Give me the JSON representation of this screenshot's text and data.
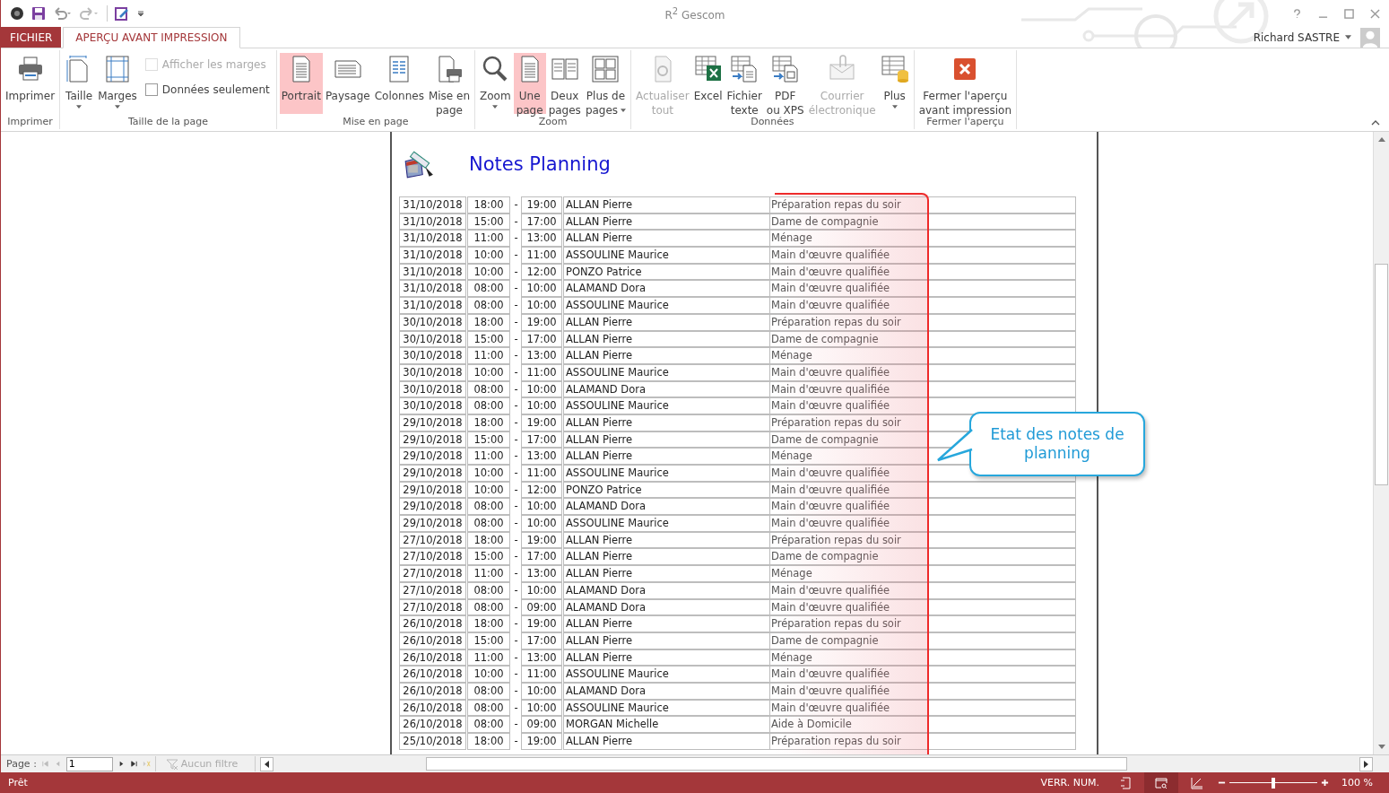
{
  "window": {
    "title": "R$^{2}$ Gescom"
  },
  "user": {
    "name": "Richard SASTRE"
  },
  "tabs": [
    {
      "label": "FICHIER",
      "kind": "file",
      "selected": false
    },
    {
      "label": "APERÇU AVANT IMPRESSION",
      "kind": "tab",
      "selected": true
    }
  ],
  "ribbon": {
    "groups": [
      {
        "label": "Imprimer",
        "items": [
          {
            "kind": "button",
            "lines": [
              "Imprimer"
            ],
            "selected": false,
            "disabled": false,
            "dropdown": false
          }
        ]
      },
      {
        "label": "Taille de la page",
        "items": [
          {
            "kind": "button",
            "lines": [
              "Taille"
            ],
            "selected": false,
            "disabled": false,
            "dropdown": true
          },
          {
            "kind": "button",
            "lines": [
              "Marges"
            ],
            "selected": false,
            "disabled": false,
            "dropdown": true
          },
          {
            "kind": "checks",
            "checks": [
              {
                "label": "Afficher les marges",
                "checked": false,
                "disabled": true
              },
              {
                "label": "Données seulement",
                "checked": false,
                "disabled": false
              }
            ]
          }
        ]
      },
      {
        "label": "Mise en page",
        "items": [
          {
            "kind": "button",
            "lines": [
              "Portrait"
            ],
            "selected": true,
            "disabled": false,
            "dropdown": false
          },
          {
            "kind": "button",
            "lines": [
              "Paysage"
            ],
            "selected": false,
            "disabled": false,
            "dropdown": false
          },
          {
            "kind": "button",
            "lines": [
              "Colonnes"
            ],
            "selected": false,
            "disabled": false,
            "dropdown": false
          },
          {
            "kind": "button",
            "lines": [
              "Mise en",
              "page"
            ],
            "selected": false,
            "disabled": false,
            "dropdown": false
          }
        ]
      },
      {
        "label": "Zoom",
        "items": [
          {
            "kind": "button",
            "lines": [
              "Zoom"
            ],
            "selected": false,
            "disabled": false,
            "dropdown": true
          },
          {
            "kind": "button",
            "lines": [
              "Une",
              "page"
            ],
            "selected": true,
            "disabled": false,
            "dropdown": false
          },
          {
            "kind": "button",
            "lines": [
              "Deux",
              "pages"
            ],
            "selected": false,
            "disabled": false,
            "dropdown": false
          },
          {
            "kind": "button",
            "lines": [
              "Plus de",
              "pages"
            ],
            "selected": false,
            "disabled": false,
            "dropdown": true
          }
        ]
      },
      {
        "label": "Données",
        "items": [
          {
            "kind": "button",
            "lines": [
              "Actualiser",
              "tout"
            ],
            "selected": false,
            "disabled": true,
            "dropdown": false
          },
          {
            "kind": "button",
            "lines": [
              "Excel"
            ],
            "selected": false,
            "disabled": false,
            "dropdown": false
          },
          {
            "kind": "button",
            "lines": [
              "Fichier",
              "texte"
            ],
            "selected": false,
            "disabled": false,
            "dropdown": false
          },
          {
            "kind": "button",
            "lines": [
              "PDF",
              "ou XPS"
            ],
            "selected": false,
            "disabled": false,
            "dropdown": false
          },
          {
            "kind": "button",
            "lines": [
              "Courrier",
              "électronique"
            ],
            "selected": false,
            "disabled": true,
            "dropdown": false
          },
          {
            "kind": "button",
            "lines": [
              "Plus"
            ],
            "selected": false,
            "disabled": false,
            "dropdown": true
          }
        ]
      },
      {
        "label": "Fermer l'aperçu",
        "items": [
          {
            "kind": "button",
            "lines": [
              "Fermer l'aperçu",
              "avant impression"
            ],
            "selected": false,
            "disabled": false,
            "dropdown": false
          }
        ]
      }
    ]
  },
  "report": {
    "title": "Notes Planning",
    "rows": [
      {
        "date": "31/10/2018",
        "start": "18:00",
        "sep": "-",
        "end": "19:00",
        "name": "ALLAN Pierre",
        "task": "Préparation repas du soir"
      },
      {
        "date": "31/10/2018",
        "start": "15:00",
        "sep": "-",
        "end": "17:00",
        "name": "ALLAN Pierre",
        "task": "Dame de compagnie"
      },
      {
        "date": "31/10/2018",
        "start": "11:00",
        "sep": "-",
        "end": "13:00",
        "name": "ALLAN Pierre",
        "task": "Ménage"
      },
      {
        "date": "31/10/2018",
        "start": "10:00",
        "sep": "-",
        "end": "11:00",
        "name": "ASSOULINE Maurice",
        "task": "Main d'œuvre qualifiée"
      },
      {
        "date": "31/10/2018",
        "start": "10:00",
        "sep": "-",
        "end": "12:00",
        "name": "PONZO Patrice",
        "task": "Main d'œuvre qualifiée"
      },
      {
        "date": "31/10/2018",
        "start": "08:00",
        "sep": "-",
        "end": "10:00",
        "name": "ALAMAND Dora",
        "task": "Main d'œuvre qualifiée"
      },
      {
        "date": "31/10/2018",
        "start": "08:00",
        "sep": "-",
        "end": "10:00",
        "name": "ASSOULINE Maurice",
        "task": "Main d'œuvre qualifiée"
      },
      {
        "date": "30/10/2018",
        "start": "18:00",
        "sep": "-",
        "end": "19:00",
        "name": "ALLAN Pierre",
        "task": "Préparation repas du soir"
      },
      {
        "date": "30/10/2018",
        "start": "15:00",
        "sep": "-",
        "end": "17:00",
        "name": "ALLAN Pierre",
        "task": "Dame de compagnie"
      },
      {
        "date": "30/10/2018",
        "start": "11:00",
        "sep": "-",
        "end": "13:00",
        "name": "ALLAN Pierre",
        "task": "Ménage"
      },
      {
        "date": "30/10/2018",
        "start": "10:00",
        "sep": "-",
        "end": "11:00",
        "name": "ASSOULINE Maurice",
        "task": "Main d'œuvre qualifiée"
      },
      {
        "date": "30/10/2018",
        "start": "08:00",
        "sep": "-",
        "end": "10:00",
        "name": "ALAMAND Dora",
        "task": "Main d'œuvre qualifiée"
      },
      {
        "date": "30/10/2018",
        "start": "08:00",
        "sep": "-",
        "end": "10:00",
        "name": "ASSOULINE Maurice",
        "task": "Main d'œuvre qualifiée"
      },
      {
        "date": "29/10/2018",
        "start": "18:00",
        "sep": "-",
        "end": "19:00",
        "name": "ALLAN Pierre",
        "task": "Préparation repas du soir"
      },
      {
        "date": "29/10/2018",
        "start": "15:00",
        "sep": "-",
        "end": "17:00",
        "name": "ALLAN Pierre",
        "task": "Dame de compagnie"
      },
      {
        "date": "29/10/2018",
        "start": "11:00",
        "sep": "-",
        "end": "13:00",
        "name": "ALLAN Pierre",
        "task": "Ménage"
      },
      {
        "date": "29/10/2018",
        "start": "10:00",
        "sep": "-",
        "end": "11:00",
        "name": "ASSOULINE Maurice",
        "task": "Main d'œuvre qualifiée"
      },
      {
        "date": "29/10/2018",
        "start": "10:00",
        "sep": "-",
        "end": "12:00",
        "name": "PONZO Patrice",
        "task": "Main d'œuvre qualifiée"
      },
      {
        "date": "29/10/2018",
        "start": "08:00",
        "sep": "-",
        "end": "10:00",
        "name": "ALAMAND Dora",
        "task": "Main d'œuvre qualifiée"
      },
      {
        "date": "29/10/2018",
        "start": "08:00",
        "sep": "-",
        "end": "10:00",
        "name": "ASSOULINE Maurice",
        "task": "Main d'œuvre qualifiée"
      },
      {
        "date": "27/10/2018",
        "start": "18:00",
        "sep": "-",
        "end": "19:00",
        "name": "ALLAN Pierre",
        "task": "Préparation repas du soir"
      },
      {
        "date": "27/10/2018",
        "start": "15:00",
        "sep": "-",
        "end": "17:00",
        "name": "ALLAN Pierre",
        "task": "Dame de compagnie"
      },
      {
        "date": "27/10/2018",
        "start": "11:00",
        "sep": "-",
        "end": "13:00",
        "name": "ALLAN Pierre",
        "task": "Ménage"
      },
      {
        "date": "27/10/2018",
        "start": "08:00",
        "sep": "-",
        "end": "10:00",
        "name": "ALAMAND Dora",
        "task": "Main d'œuvre qualifiée"
      },
      {
        "date": "27/10/2018",
        "start": "08:00",
        "sep": "-",
        "end": "09:00",
        "name": "ALAMAND Dora",
        "task": "Main d'œuvre qualifiée"
      },
      {
        "date": "26/10/2018",
        "start": "18:00",
        "sep": "-",
        "end": "19:00",
        "name": "ALLAN Pierre",
        "task": "Préparation repas du soir"
      },
      {
        "date": "26/10/2018",
        "start": "15:00",
        "sep": "-",
        "end": "17:00",
        "name": "ALLAN Pierre",
        "task": "Dame de compagnie"
      },
      {
        "date": "26/10/2018",
        "start": "11:00",
        "sep": "-",
        "end": "13:00",
        "name": "ALLAN Pierre",
        "task": "Ménage"
      },
      {
        "date": "26/10/2018",
        "start": "10:00",
        "sep": "-",
        "end": "11:00",
        "name": "ASSOULINE Maurice",
        "task": "Main d'œuvre qualifiée"
      },
      {
        "date": "26/10/2018",
        "start": "08:00",
        "sep": "-",
        "end": "10:00",
        "name": "ALAMAND Dora",
        "task": "Main d'œuvre qualifiée"
      },
      {
        "date": "26/10/2018",
        "start": "08:00",
        "sep": "-",
        "end": "10:00",
        "name": "ASSOULINE Maurice",
        "task": "Main d'œuvre qualifiée"
      },
      {
        "date": "26/10/2018",
        "start": "08:00",
        "sep": "-",
        "end": "09:00",
        "name": "MORGAN Michelle",
        "task": "Aide à Domicile"
      },
      {
        "date": "25/10/2018",
        "start": "18:00",
        "sep": "-",
        "end": "19:00",
        "name": "ALLAN Pierre",
        "task": "Préparation repas du soir"
      }
    ]
  },
  "callout": {
    "text": "Etat des notes de planning"
  },
  "navigation": {
    "label": "Page :",
    "page": "1",
    "filter": "Aucun filtre"
  },
  "status_bar": {
    "text": "Prêt",
    "indicator": "VERR. NUM.",
    "views": [
      {
        "selected": false
      },
      {
        "selected": true
      },
      {
        "selected": false
      }
    ],
    "zoom_slider": {
      "level": 0.5
    },
    "zoom": "100 %"
  }
}
